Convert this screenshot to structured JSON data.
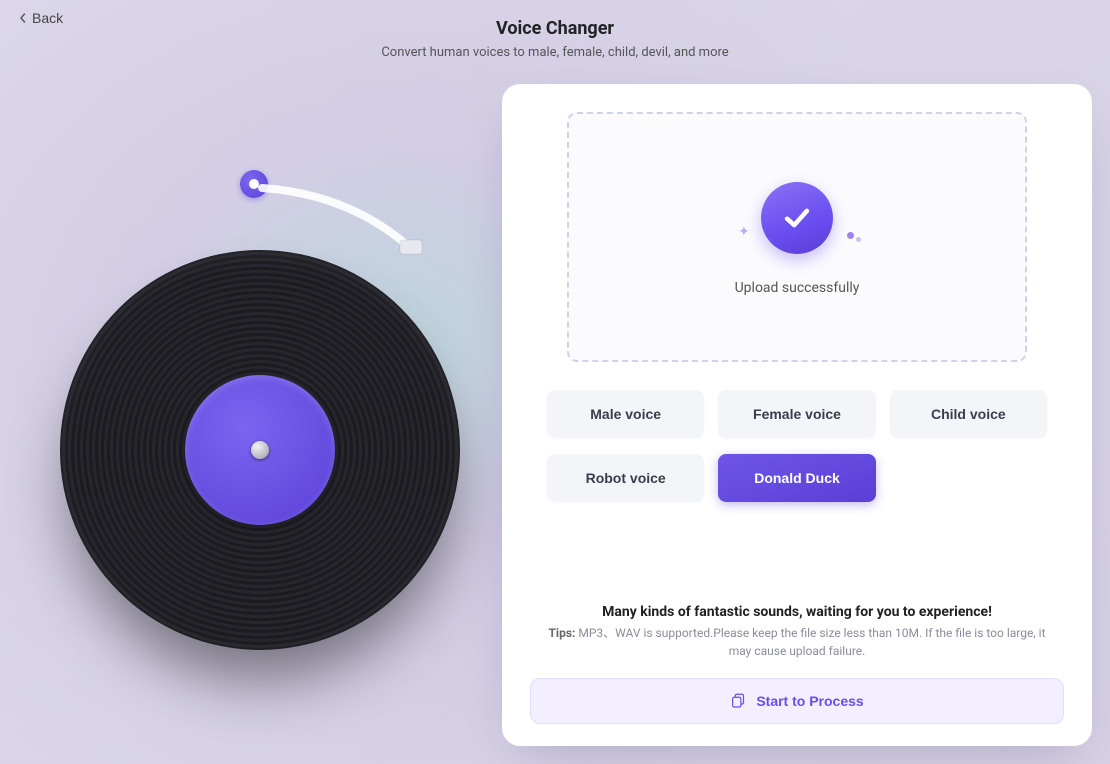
{
  "nav": {
    "back_label": "Back"
  },
  "header": {
    "title": "Voice Changer",
    "subtitle": "Convert human voices to male, female, child, devil, and more"
  },
  "upload": {
    "status_text": "Upload successfully"
  },
  "voices": {
    "options": [
      {
        "label": "Male voice",
        "selected": false
      },
      {
        "label": "Female voice",
        "selected": false
      },
      {
        "label": "Child voice",
        "selected": false
      },
      {
        "label": "Robot voice",
        "selected": false
      },
      {
        "label": "Donald Duck",
        "selected": true
      }
    ]
  },
  "promo": {
    "headline": "Many kinds of fantastic sounds, waiting for you to experience!",
    "tips_label": "Tips:",
    "tips_body": "MP3、WAV is supported.Please keep the file size less than 10M. If the file is too large, it may cause upload failure."
  },
  "action": {
    "process_label": "Start to Process"
  },
  "colors": {
    "accent": "#5a3fd6"
  }
}
